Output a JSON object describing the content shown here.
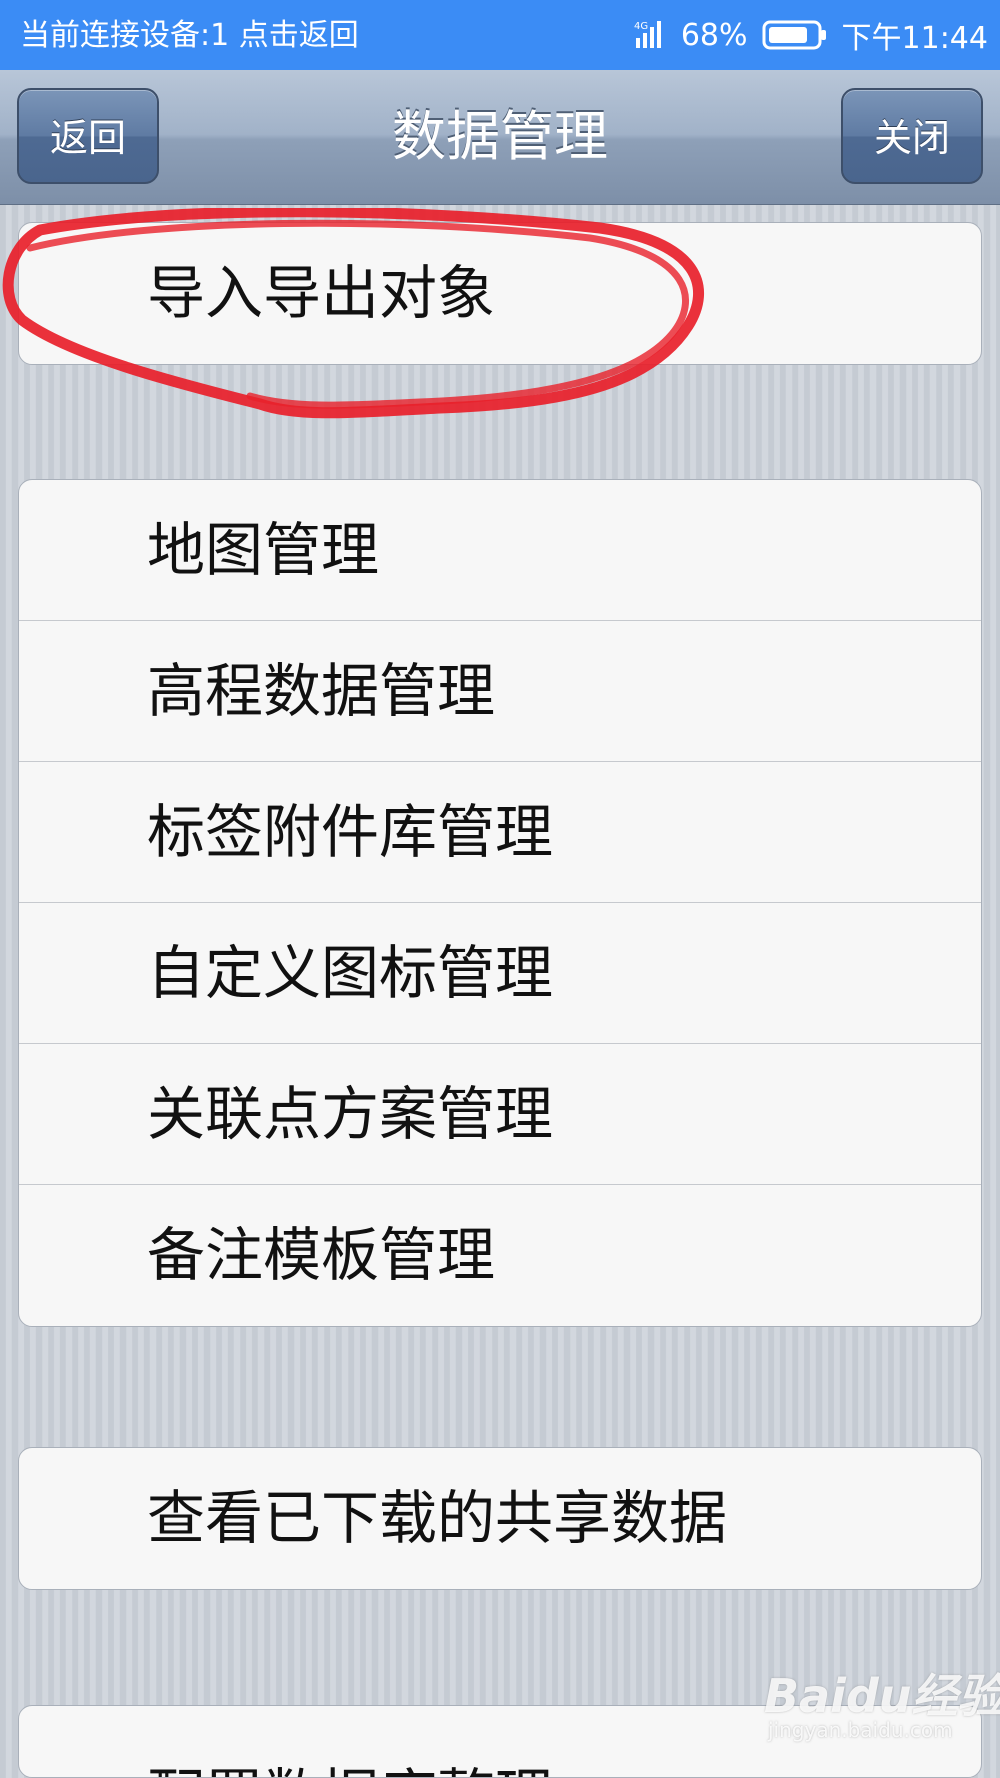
{
  "status_bar": {
    "left_text": "当前连接设备:1  点击返回",
    "network_label": "4G",
    "battery_percent": "68%",
    "time": "下午11:44",
    "icons": [
      "signal-icon",
      "battery-icon"
    ]
  },
  "nav": {
    "title": "数据管理",
    "back_label": "返回",
    "close_label": "关闭"
  },
  "groups": [
    {
      "items": [
        "导入导出对象"
      ]
    },
    {
      "items": [
        "地图管理",
        "高程数据管理",
        "标签附件库管理",
        "自定义图标管理",
        "关联点方案管理",
        "备注模板管理"
      ]
    },
    {
      "items": [
        "查看已下载的共享数据"
      ]
    },
    {
      "items": [
        "配置数据库整理"
      ]
    }
  ],
  "annotation": {
    "type": "hand-drawn red circle",
    "target": "导入导出对象",
    "color": "#e8202a"
  },
  "watermark": {
    "logo": "Baidu经验",
    "url": "jingyan.baidu.com"
  },
  "colors": {
    "status_bar": "#3b8cf5",
    "nav_bar": "#8ea0b8",
    "nav_button": "#5f7ba3",
    "background": "#c9ced6",
    "row_background": "#f7f7f7",
    "annotation": "#e8202a"
  }
}
